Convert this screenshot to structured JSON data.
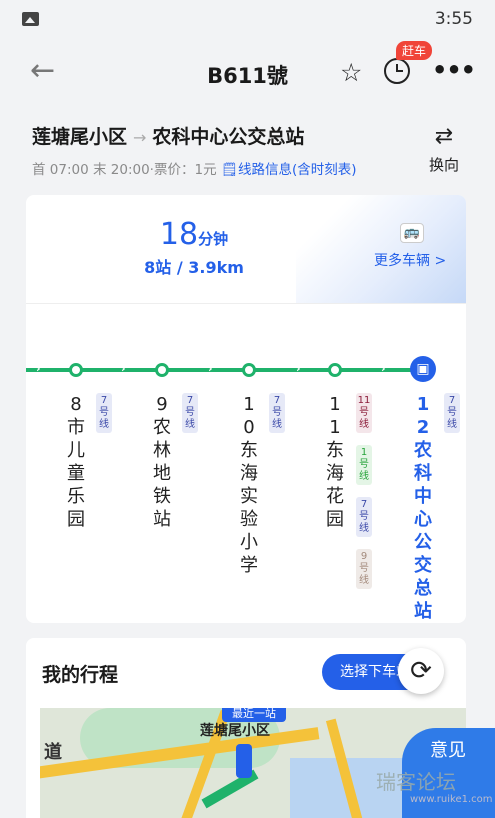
{
  "status_bar": {
    "time": "3:55"
  },
  "header": {
    "title": "B611號",
    "badge": "赶车"
  },
  "route": {
    "from": "莲塘尾小区",
    "to": "农科中心公交总站",
    "meta_prefix": "首 07:00 末 20:00·票价：1元",
    "info_link": "线路信息(含时刻表)",
    "swap_label": "换向"
  },
  "eta": {
    "minutes": "18",
    "unit": "分钟",
    "summary": "8站 / 3.9km",
    "more_buses": "更多车辆 >"
  },
  "stops": [
    {
      "number": "8",
      "name": "市儿童乐园",
      "lines": [
        "7号线"
      ]
    },
    {
      "number": "9",
      "name": "农林地铁站",
      "lines": [
        "7号线"
      ]
    },
    {
      "number": "10",
      "name": "东海实验小学",
      "lines": [
        "7号线"
      ]
    },
    {
      "number": "11",
      "name": "东海花园",
      "lines": [
        "11号线",
        "1号线",
        "7号线",
        "9号线"
      ]
    },
    {
      "number": "12",
      "name": "农科中心公交总站",
      "lines": [
        "7号线"
      ]
    }
  ],
  "trip": {
    "heading": "我的行程",
    "next_stop_button": "选择下车站",
    "map_stop_flag": "最近一站",
    "map_stop_name": "莲塘尾小区",
    "map_road_label": "道"
  },
  "feedback": "意见",
  "watermark": "瑞客论坛",
  "watermark_url": "www.ruike1.com",
  "colors": {
    "accent": "#2460e8",
    "route_green": "#1fb26b",
    "badge_red": "#f04438"
  }
}
